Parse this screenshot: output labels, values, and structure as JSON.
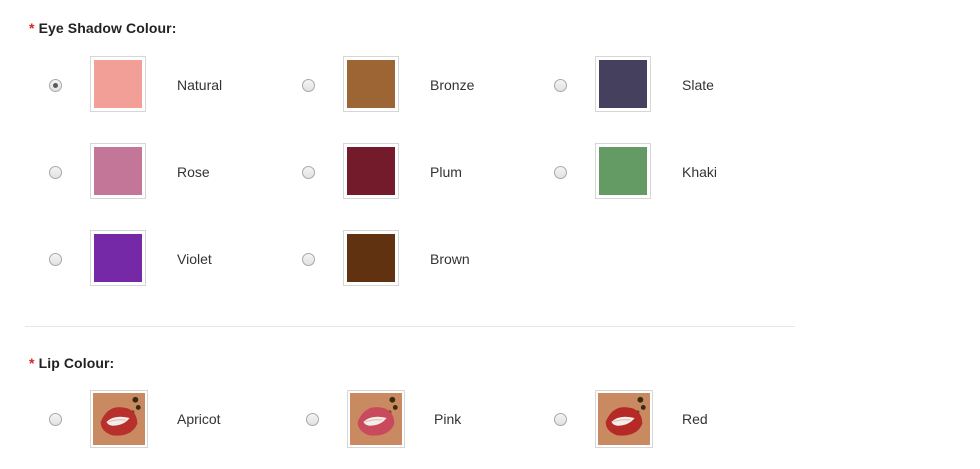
{
  "eye_shadow": {
    "required_mark": "*",
    "title": "Eye Shadow Colour:",
    "options": [
      {
        "label": "Natural",
        "color": "#f29f98",
        "checked": true
      },
      {
        "label": "Bronze",
        "color": "#9c6533",
        "checked": false
      },
      {
        "label": "Slate",
        "color": "#44405e",
        "checked": false
      },
      {
        "label": "Rose",
        "color": "#c47699",
        "checked": false
      },
      {
        "label": "Plum",
        "color": "#741b2b",
        "checked": false
      },
      {
        "label": "Khaki",
        "color": "#649b65",
        "checked": false
      },
      {
        "label": "Violet",
        "color": "#7529a6",
        "checked": false
      },
      {
        "label": "Brown",
        "color": "#60320f",
        "checked": false
      }
    ]
  },
  "lip": {
    "required_mark": "*",
    "title": "Lip Colour:",
    "options": [
      {
        "label": "Apricot",
        "checked": false
      },
      {
        "label": "Pink",
        "checked": false
      },
      {
        "label": "Red",
        "checked": false
      }
    ]
  }
}
